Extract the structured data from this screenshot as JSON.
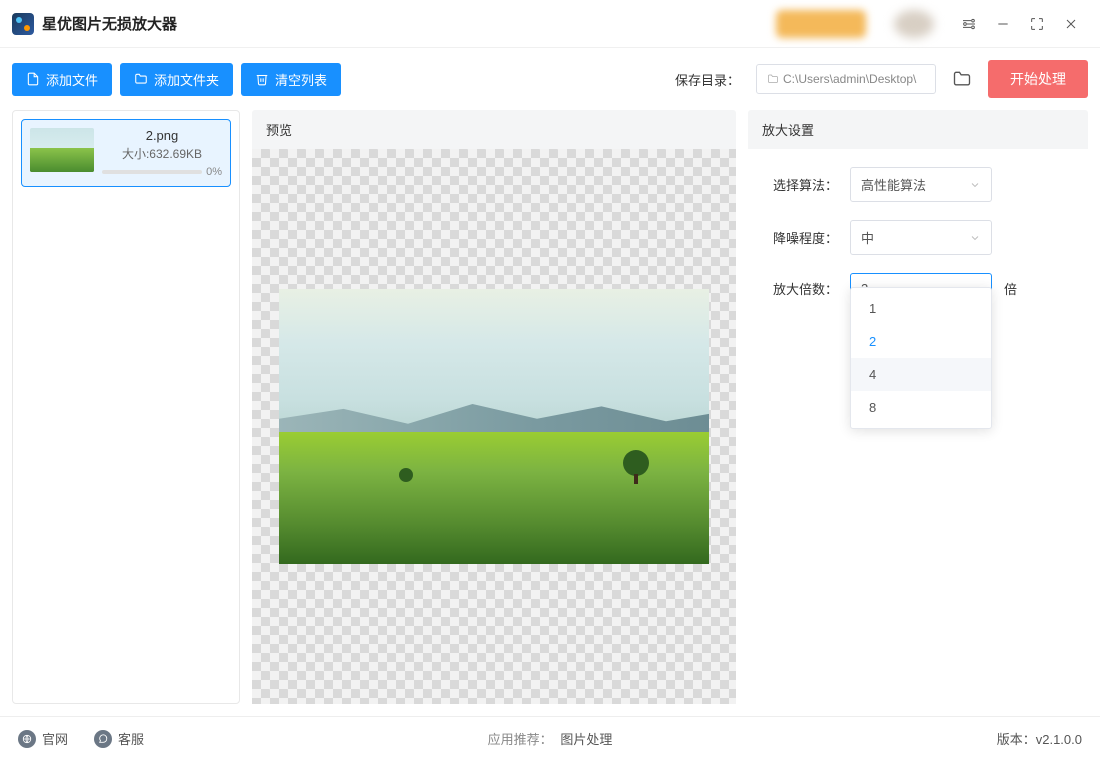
{
  "titlebar": {
    "title": "星优图片无损放大器"
  },
  "toolbar": {
    "add_file": "添加文件",
    "add_folder": "添加文件夹",
    "clear_list": "清空列表",
    "save_dir_label": "保存目录：",
    "save_dir_path": "C:\\Users\\admin\\Desktop\\",
    "start": "开始处理"
  },
  "filelist": {
    "items": [
      {
        "name": "2.png",
        "size_label": "大小:632.69KB",
        "progress": "0%"
      }
    ]
  },
  "preview": {
    "header": "预览"
  },
  "settings": {
    "header": "放大设置",
    "algorithm_label": "选择算法：",
    "algorithm_value": "高性能算法",
    "denoise_label": "降噪程度：",
    "denoise_value": "中",
    "scale_label": "放大倍数：",
    "scale_value": "2",
    "scale_suffix": "倍",
    "scale_options": [
      "1",
      "2",
      "4",
      "8"
    ],
    "scale_selected_index": 1,
    "scale_hover_index": 2
  },
  "footer": {
    "website": "官网",
    "support": "客服",
    "recommend_label": "应用推荐：",
    "recommend_app": "图片处理",
    "version_label": "版本：",
    "version": "v2.1.0.0"
  }
}
